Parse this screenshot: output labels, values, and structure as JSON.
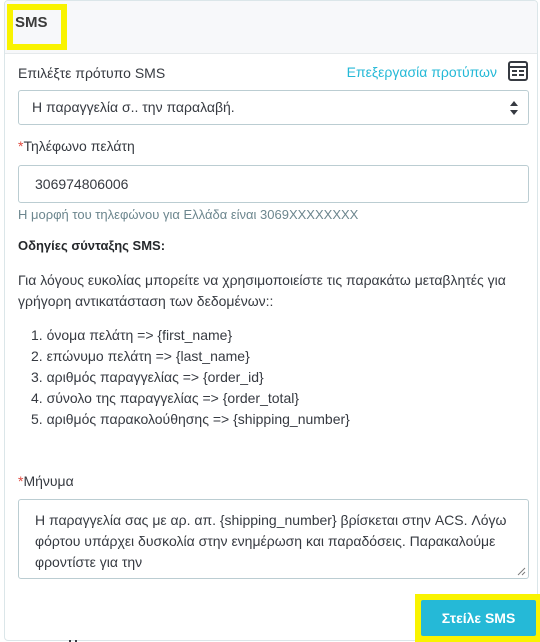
{
  "panel": {
    "title": "SMS"
  },
  "template": {
    "label": "Επιλέξτε πρότυπο SMS",
    "edit_link": "Επεξεργασία προτύπων",
    "edit_icon": "template-edit-icon",
    "selected": "Η παραγγελία σ.. την παραλαβή."
  },
  "phone": {
    "required_mark": "*",
    "label": "Τηλέφωνο πελάτη",
    "value": "306974806006",
    "help": "Η μορφή του τηλεφώνου για Ελλάδα είναι 3069XXXXXXXX"
  },
  "instructions": {
    "title": "Οδηγίες σύνταξης SMS:",
    "text": "Για λόγους ευκολίας μπορείτε να χρησιμοποιείστε τις παρακάτω μεταβλητές για γρήγορη αντικατάσταση των δεδομένων::",
    "items": [
      "1. όνομα πελάτη => {first_name}",
      "2. επώνυμο πελάτη => {last_name}",
      "3. αριθμός παραγγελίας => {order_id}",
      "4. σύνολο της παραγγελίας => {order_total}",
      "5. αριθμός παρακολούθησης => {shipping_number}"
    ]
  },
  "message": {
    "required_mark": "*",
    "label": "Μήνυμα",
    "value": "Η παραγγελία σας με αρ. απ. {shipping_number} βρίσκεται στην ACS. Λόγω φόρτου υπάρχει δυσκολία στην ενημέρωση και παραδόσεις. Παρακαλούμε φροντίστε για την"
  },
  "actions": {
    "send_label": "Στείλε SMS"
  },
  "colors": {
    "accent": "#25b9d7",
    "highlight": "#f9f300",
    "required": "#e04a3f"
  }
}
